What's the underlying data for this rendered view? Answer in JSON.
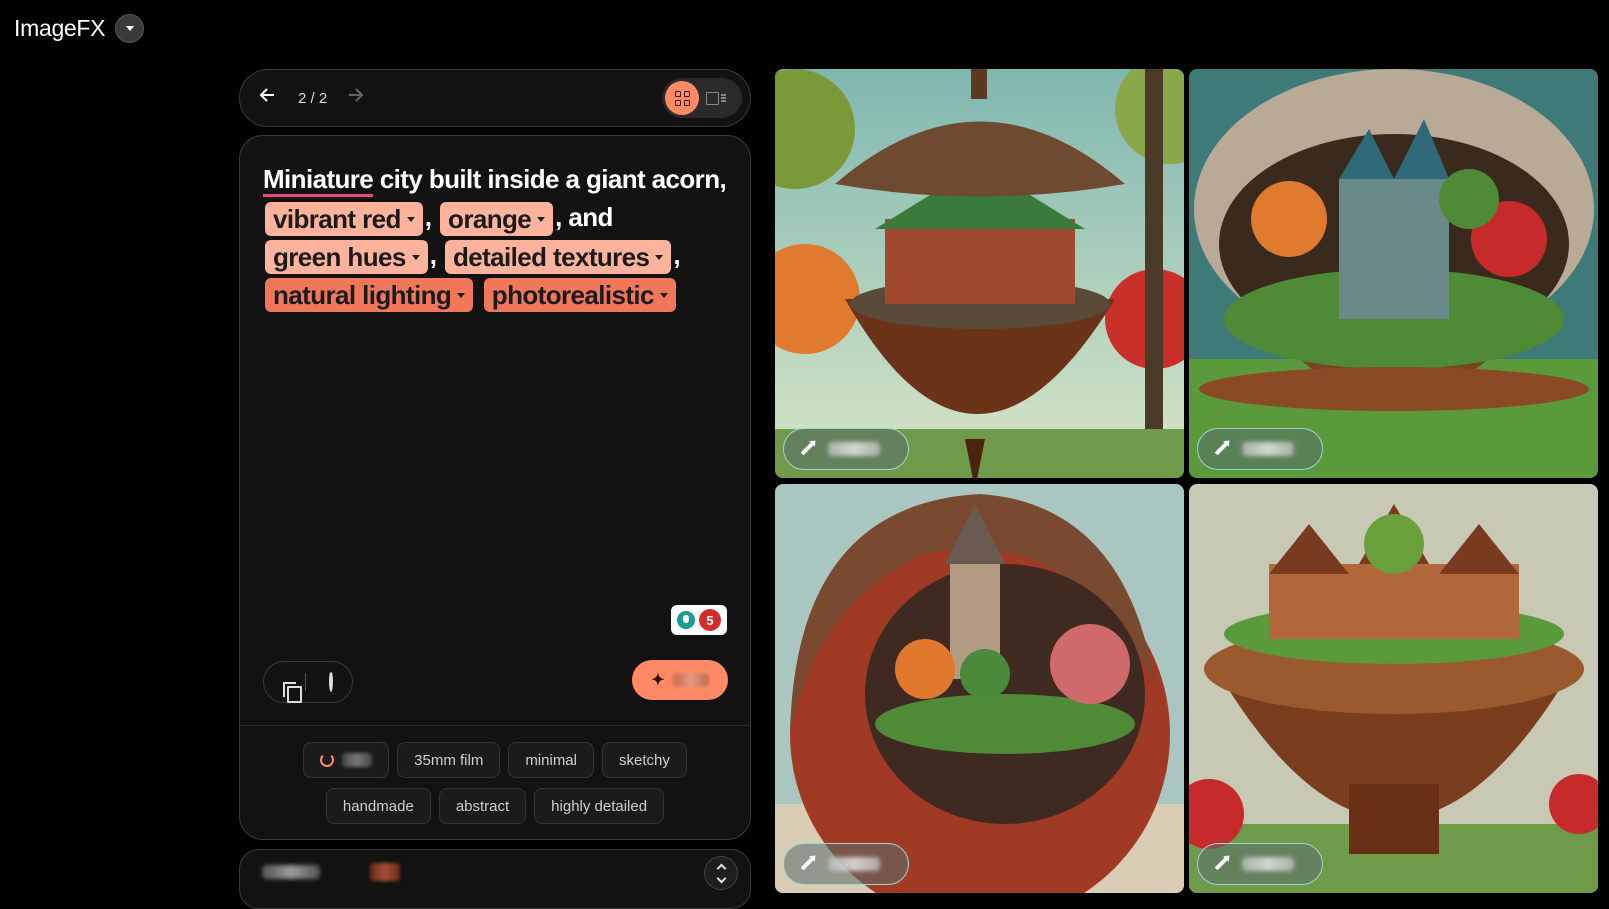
{
  "app": {
    "title": "ImageFX"
  },
  "nav": {
    "page_indicator": "2 / 2",
    "prev_icon": "arrow-left-icon",
    "next_icon": "arrow-right-icon"
  },
  "prompt": {
    "text_before_1": "Miniature",
    "text_1": " city built inside a giant acorn,",
    "chips": [
      {
        "label": "vibrant red",
        "style": "light"
      },
      {
        "label": "orange",
        "style": "light"
      },
      {
        "label": "green hues",
        "style": "light"
      },
      {
        "label": "detailed textures",
        "style": "light"
      },
      {
        "label": "natural lighting",
        "style": "dark"
      },
      {
        "label": "photorealistic",
        "style": "dark"
      }
    ],
    "sep_comma": ",",
    "text_and": "and"
  },
  "language_tool": {
    "issue_count": "5"
  },
  "suggestions": {
    "row1": [
      "35mm film",
      "minimal",
      "sketchy"
    ],
    "row2": [
      "handmade",
      "abstract",
      "highly detailed"
    ]
  },
  "colors": {
    "accent": "#ff8a65",
    "chip_light": "#ffb39d",
    "chip_dark": "#f0775a",
    "background": "#000000",
    "panel": "#121212"
  }
}
